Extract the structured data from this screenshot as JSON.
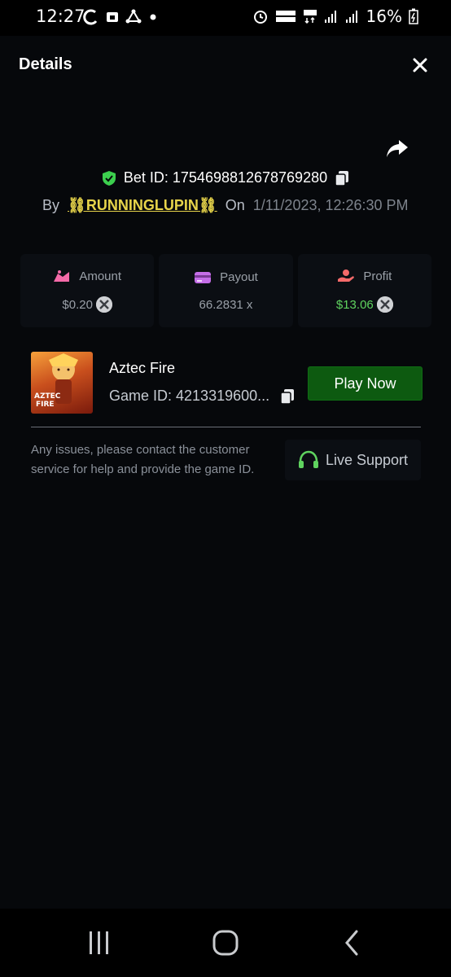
{
  "status_bar": {
    "time": "12:27",
    "battery": "16%"
  },
  "header": {
    "title": "Details"
  },
  "bet": {
    "id_label": "Bet ID: 1754698812678769280",
    "by_label": "By",
    "user": "⛓RUNNINGLUPIN⛓",
    "on_label": "On",
    "date": "1/11/2023, 12:26:30 PM"
  },
  "stats": {
    "amount_label": "Amount",
    "amount_value": "$0.20",
    "payout_label": "Payout",
    "payout_value": "66.2831 x",
    "profit_label": "Profit",
    "profit_value": "$13.06"
  },
  "game": {
    "name": "Aztec Fire",
    "id_text": "Game ID: 4213319600...",
    "thumb_text_1": "AZTEC",
    "thumb_text_2": "FIRE",
    "play_label": "Play Now"
  },
  "support": {
    "issues_text": "Any issues, please contact the customer service for help and provide the game ID.",
    "live_support_label": "Live Support"
  },
  "colors": {
    "profit_green": "#5fd35f",
    "play_button": "#0d5a10",
    "username_yellow": "#e7d44a",
    "shield_green": "#3ccf4e"
  }
}
